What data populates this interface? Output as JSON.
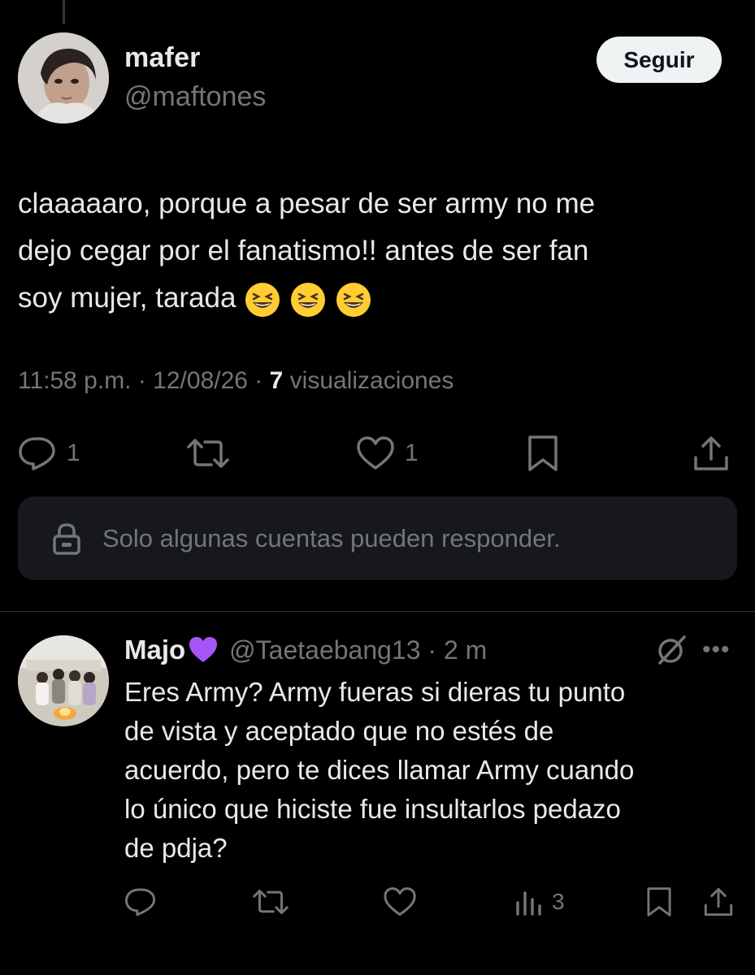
{
  "tweet": {
    "author_name": "mafer",
    "author_handle": "@maftones",
    "follow_label": "Seguir",
    "text": "claaaaaro, porque a pesar de ser army no me\ndejo cegar por el fanatismo!! antes de ser fan\nsoy mujer, tarada",
    "emojis": [
      "grinning-squinting-face",
      "grinning-squinting-face",
      "grinning-squinting-face"
    ],
    "timestamp": "11:58 p.m. · 12/08/26 · ",
    "views_count": "7",
    "views_label": " visualizaciones",
    "actions": {
      "replies": "1",
      "likes": "1"
    },
    "reply_restriction": "Solo algunas cuentas pueden responder."
  },
  "reply": {
    "author_name": "Majo",
    "author_emoji": "purple-heart",
    "author_handle": "@Taetaebang13 · 2 m",
    "text": "Eres Army? Army fueras si dieras tu punto\nde vista y aceptado que no estés de\nacuerdo, pero te dices llamar Army cuando\nlo único que hiciste fue insultarlos pedazo\nde pdja?",
    "actions": {
      "views": "3"
    }
  },
  "colors": {
    "background": "#000000",
    "text": "#e7e9ea",
    "muted": "#71767b",
    "follow_bg": "#eff3f4",
    "panel": "#16181c",
    "purple_heart": "#a855f7"
  }
}
